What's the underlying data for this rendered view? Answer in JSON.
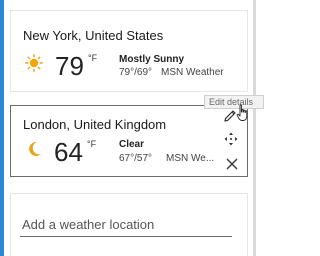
{
  "locations": [
    {
      "name": "New York, United States",
      "icon": "sun-icon",
      "temperature": "79",
      "unit": "°F",
      "condition": "Mostly Sunny",
      "high_low": "79°/69°",
      "source": "MSN Weather"
    },
    {
      "name": "London, United Kingdom",
      "icon": "moon-icon",
      "temperature": "64",
      "unit": "°F",
      "condition": "Clear",
      "high_low": "67°/57°",
      "source": "MSN We..."
    }
  ],
  "tooltip": "Edit details",
  "actions": {
    "edit_icon": "pencil-icon",
    "move_icon": "move-icon",
    "delete_icon": "close-icon"
  },
  "add_location": {
    "placeholder": "Add a weather location",
    "value": ""
  },
  "colors": {
    "accent": "#2d88d8",
    "sun": "#f5a30b",
    "moon": "#e8a317",
    "selected_border": "#6b6b6b"
  }
}
